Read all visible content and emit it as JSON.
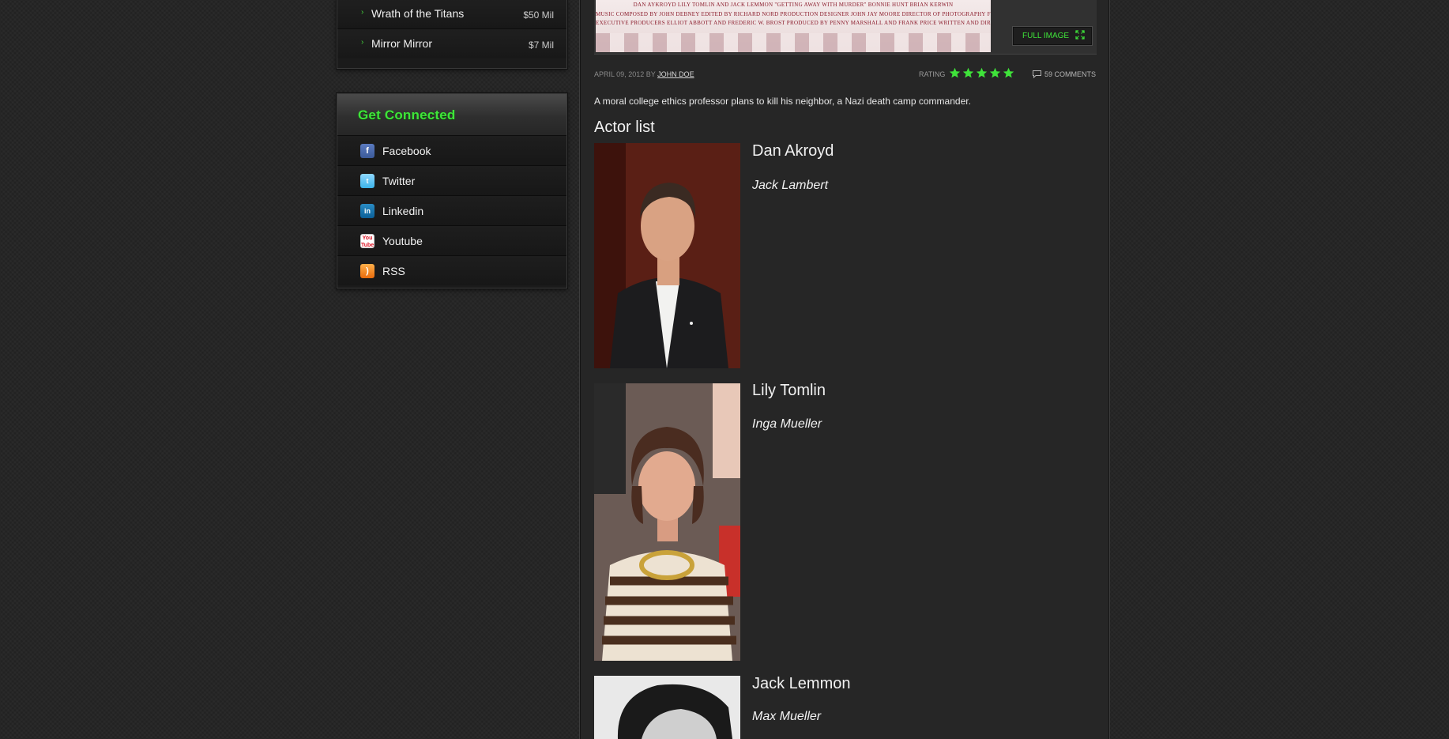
{
  "box_office": [
    {
      "title": "Wrath of the Titans",
      "gross": "$50 Mil"
    },
    {
      "title": "Mirror Mirror",
      "gross": "$7 Mil"
    }
  ],
  "connected": {
    "title": "Get Connected",
    "links": [
      {
        "label": "Facebook",
        "icon": "facebook-icon",
        "glyph": "f"
      },
      {
        "label": "Twitter",
        "icon": "twitter-icon",
        "glyph": "t"
      },
      {
        "label": "Linkedin",
        "icon": "linkedin-icon",
        "glyph": "in"
      },
      {
        "label": "Youtube",
        "icon": "youtube-icon",
        "glyph": "You Tube"
      },
      {
        "label": "RSS",
        "icon": "rss-icon",
        "glyph": ")"
      }
    ]
  },
  "hero": {
    "poster_lines": [
      "DAN AYKROYD  LILY TOMLIN AND JACK LEMMON \"GETTING AWAY WITH MURDER\" BONNIE HUNT  BRIAN KERWIN",
      "MUSIC COMPOSED BY JOHN DEBNEY  EDITED BY RICHARD NORD  PRODUCTION DESIGNER JOHN JAY MOORE  DIRECTOR OF PHOTOGRAPHY FRANK TIDY, B.S.C.",
      "EXECUTIVE PRODUCERS ELLIOT ABBOTT AND FREDERIC W. BROST  PRODUCED BY PENNY MARSHALL AND FRANK PRICE  WRITTEN AND DIRECTED BY HARVEY MILLER"
    ],
    "full_image_label": "FULL IMAGE"
  },
  "meta": {
    "date": "APRIL 09, 2012 BY ",
    "author": "JOHN DOE",
    "rating_label": "RATING",
    "rating": 5,
    "rating_max": 5,
    "comments": "59 COMMENTS"
  },
  "colors": {
    "accent": "#3fe33a",
    "background": "#262626"
  },
  "summary": "A moral college ethics professor plans to kill his neighbor, a Nazi death camp commander.",
  "actor_heading": "Actor list",
  "actors": [
    {
      "name": "Dan Akroyd",
      "role": "Jack Lambert"
    },
    {
      "name": "Lily Tomlin",
      "role": "Inga Mueller"
    },
    {
      "name": "Jack Lemmon",
      "role": "Max Mueller"
    }
  ]
}
